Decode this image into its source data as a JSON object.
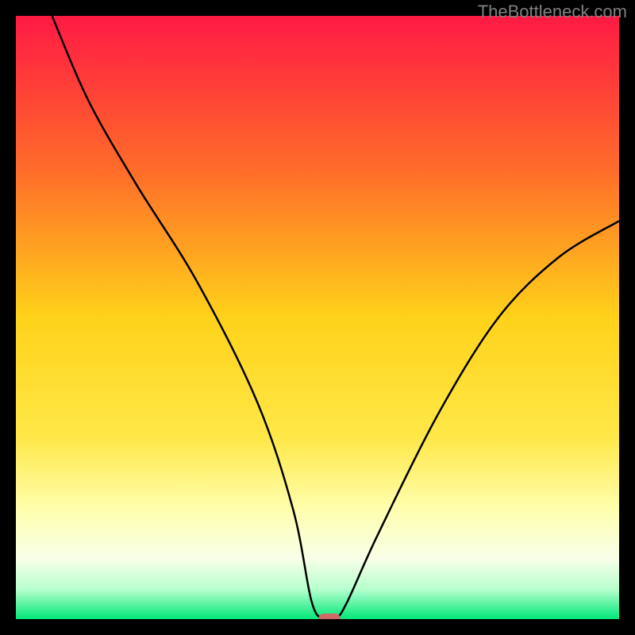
{
  "watermark": "TheBottleneck.com",
  "chart_data": {
    "type": "line",
    "title": "",
    "xlabel": "",
    "ylabel": "",
    "xlim": [
      0,
      100
    ],
    "ylim": [
      0,
      100
    ],
    "series": [
      {
        "name": "bottleneck-curve",
        "x": [
          6,
          12,
          20,
          30,
          40,
          46,
          49,
          51,
          53,
          55,
          60,
          70,
          80,
          90,
          100
        ],
        "values": [
          100,
          86,
          72,
          56,
          36,
          18,
          3,
          0,
          0,
          3,
          14,
          34,
          50,
          60,
          66
        ]
      }
    ],
    "marker": {
      "name": "optimal-point",
      "x": 52,
      "y": 0,
      "color": "#d06868"
    },
    "gradient_stops": [
      {
        "offset": 0,
        "color": "#ff1a44"
      },
      {
        "offset": 25,
        "color": "#ff6a2a"
      },
      {
        "offset": 50,
        "color": "#ffd21a"
      },
      {
        "offset": 70,
        "color": "#ffe848"
      },
      {
        "offset": 82,
        "color": "#ffffb0"
      },
      {
        "offset": 90,
        "color": "#f8ffe8"
      },
      {
        "offset": 95,
        "color": "#b8ffce"
      },
      {
        "offset": 100,
        "color": "#00e878"
      }
    ]
  }
}
